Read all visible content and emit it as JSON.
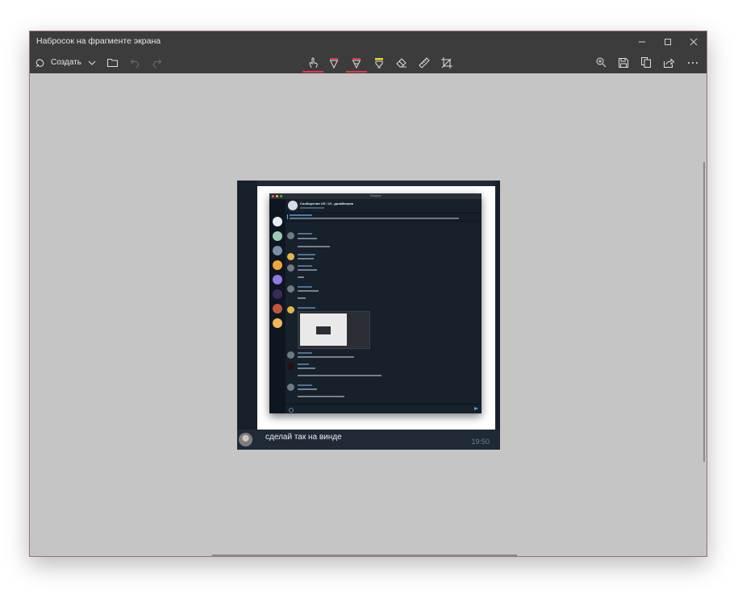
{
  "window": {
    "title": "Набросок на фрагменте экрана",
    "controls": {
      "minimize_icon": "minimize-icon",
      "maximize_icon": "maximize-icon",
      "close_icon": "close-icon"
    }
  },
  "toolbar": {
    "create_label": "Создать",
    "accent_color": "#e0384a",
    "highlighter_color": "#f5d327"
  },
  "capture": {
    "telegram_title": "Telegram",
    "chat_name": "Сообщество UX / UI - дизайнеров",
    "message_text": "сделай так на винде",
    "message_time": "19:50"
  }
}
